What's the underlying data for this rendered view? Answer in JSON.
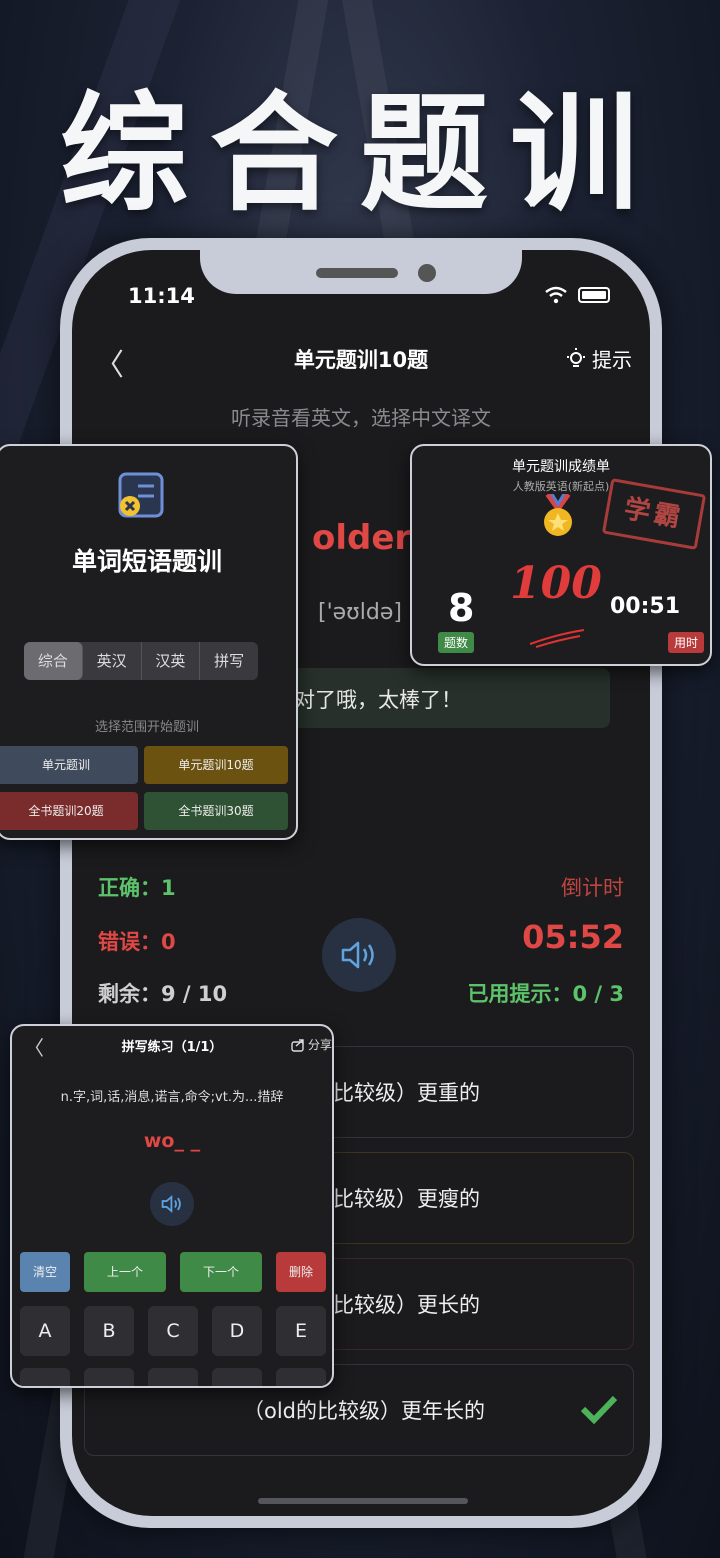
{
  "headline": "综合题训",
  "status": {
    "time": "11:14"
  },
  "nav": {
    "title": "单元题训10题",
    "hint_label": "提示"
  },
  "question": {
    "instruction": "听录音看英文，选择中文译文",
    "word": "older",
    "phonetic": "['əʊldə]",
    "feedback": "对了哦，太棒了！"
  },
  "stats": {
    "correct_label": "正确：",
    "correct": "1",
    "wrong_label": "错误：",
    "wrong": "0",
    "remaining_label": "剩余：",
    "remaining": "9 / 10",
    "countdown_label": "倒计时",
    "countdown": "05:52",
    "hints_label": "已用提示：",
    "hints": "0 / 3"
  },
  "options": [
    {
      "text": "比较级）更重的"
    },
    {
      "text": "比较级）更瘦的"
    },
    {
      "text": "比较级）更长的"
    },
    {
      "text": "（old的比较级）更年长的",
      "correct": true
    }
  ],
  "vocab_card": {
    "title": "单词短语题训",
    "tabs": [
      "综合",
      "英汉",
      "汉英",
      "拼写"
    ],
    "active_tab": "综合",
    "scope_label": "选择范围开始题训",
    "buttons": [
      {
        "label": "单元题训",
        "color": "#3f4b5c"
      },
      {
        "label": "单元题训10题",
        "color": "#6b5210"
      },
      {
        "label": "全书题训20题",
        "color": "#7a2b2b"
      },
      {
        "label": "全书题训30题",
        "color": "#305234"
      }
    ]
  },
  "score_card": {
    "title": "单元题训成绩单",
    "subtitle": "人教版英语(新起点)",
    "stamp": "学霸",
    "score": "100",
    "count": "8",
    "count_label": "题数",
    "time": "00:51",
    "time_label": "用时"
  },
  "spell_card": {
    "title": "拼写练习（1/1）",
    "share_label": "分享",
    "definition": "n.字,词,话,消息,诺言,命令;vt.为...措辞",
    "word": "wo_ _",
    "buttons": [
      {
        "label": "清空",
        "color": "#5a83b0"
      },
      {
        "label": "上一个",
        "color": "#3f8a47"
      },
      {
        "label": "下一个",
        "color": "#3f8a47"
      },
      {
        "label": "删除",
        "color": "#b83a3a"
      }
    ],
    "keys": [
      "A",
      "B",
      "C",
      "D",
      "E"
    ]
  },
  "colors": {
    "accent_red": "#e04846",
    "accent_green": "#5cc36a"
  }
}
